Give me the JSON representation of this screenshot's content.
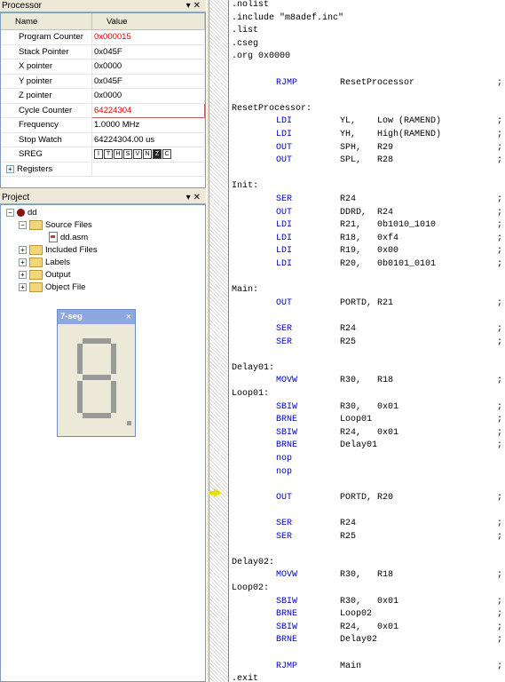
{
  "processor": {
    "title": "Processor",
    "col_name": "Name",
    "col_value": "Value",
    "rows": [
      {
        "name": "Program Counter",
        "value": "0x000015"
      },
      {
        "name": "Stack Pointer",
        "value": "0x045F"
      },
      {
        "name": "X pointer",
        "value": "0x0000"
      },
      {
        "name": "Y pointer",
        "value": "0x045F"
      },
      {
        "name": "Z pointer",
        "value": "0x0000"
      },
      {
        "name": "Cycle Counter",
        "value": "64224304"
      },
      {
        "name": "Frequency",
        "value": "1.0000 MHz"
      },
      {
        "name": "Stop Watch",
        "value": "64224304.00 us"
      },
      {
        "name": "SREG",
        "value": ""
      },
      {
        "name": "Registers",
        "value": ""
      }
    ],
    "sreg_flags": [
      "I",
      "T",
      "H",
      "S",
      "V",
      "N",
      "Z",
      "C"
    ]
  },
  "project": {
    "title": "Project",
    "root": "dd",
    "source_files": "Source Files",
    "file": "dd.asm",
    "included_files": "Included Files",
    "labels": "Labels",
    "output": "Output",
    "object_file": "Object File"
  },
  "seven_seg": {
    "title": "7-seg",
    "close": "×"
  },
  "code_lines": [
    {
      "label": ".nolist"
    },
    {
      "label": ".include \"m8adef.inc\""
    },
    {
      "label": ".list"
    },
    {
      "label": ".cseg"
    },
    {
      "label": ".org 0x0000"
    },
    {
      "label": ""
    },
    {
      "op": "RJMP",
      "args": "ResetProcessor",
      "semi": ";"
    },
    {
      "label": ""
    },
    {
      "label": "ResetProcessor:"
    },
    {
      "op": "LDI",
      "args": "YL,    Low (RAMEND)",
      "semi": ";"
    },
    {
      "op": "LDI",
      "args": "YH,    High(RAMEND)",
      "semi": ";"
    },
    {
      "op": "OUT",
      "args": "SPH,   R29",
      "semi": ";"
    },
    {
      "op": "OUT",
      "args": "SPL,   R28",
      "semi": ";"
    },
    {
      "label": ""
    },
    {
      "label": "Init:"
    },
    {
      "op": "SER",
      "args": "R24",
      "semi": ";"
    },
    {
      "op": "OUT",
      "args": "DDRD,  R24",
      "semi": ";"
    },
    {
      "op": "LDI",
      "args": "R21,   0b1010_1010",
      "semi": ";"
    },
    {
      "op": "LDI",
      "args": "R18,   0xf4",
      "semi": ";"
    },
    {
      "op": "LDI",
      "args": "R19,   0x00",
      "semi": ";"
    },
    {
      "op": "LDI",
      "args": "R20,   0b0101_0101",
      "semi": ";"
    },
    {
      "label": ""
    },
    {
      "label": "Main:"
    },
    {
      "op": "OUT",
      "args": "PORTD, R21",
      "semi": ";"
    },
    {
      "label": ""
    },
    {
      "op": "SER",
      "args": "R24",
      "semi": ";"
    },
    {
      "op": "SER",
      "args": "R25",
      "semi": ";"
    },
    {
      "label": ""
    },
    {
      "label": "Delay01:"
    },
    {
      "op": "MOVW",
      "args": "R30,   R18",
      "semi": ";"
    },
    {
      "label": "Loop01:"
    },
    {
      "op": "SBIW",
      "args": "R30,   0x01",
      "semi": ";"
    },
    {
      "op": "BRNE",
      "args": "Loop01",
      "semi": ";"
    },
    {
      "op": "SBIW",
      "args": "R24,   0x01",
      "semi": ";"
    },
    {
      "op": "BRNE",
      "args": "Delay01",
      "semi": ";"
    },
    {
      "op": "nop",
      "args": "",
      "semi": ""
    },
    {
      "op": "nop",
      "args": "",
      "semi": ""
    },
    {
      "label": ""
    },
    {
      "op": "OUT",
      "args": "PORTD, R20",
      "semi": ";"
    },
    {
      "label": ""
    },
    {
      "op": "SER",
      "args": "R24",
      "semi": ";"
    },
    {
      "op": "SER",
      "args": "R25",
      "semi": ";"
    },
    {
      "label": ""
    },
    {
      "label": "Delay02:"
    },
    {
      "op": "MOVW",
      "args": "R30,   R18",
      "semi": ";"
    },
    {
      "label": "Loop02:"
    },
    {
      "op": "SBIW",
      "args": "R30,   0x01",
      "semi": ";"
    },
    {
      "op": "BRNE",
      "args": "Loop02",
      "semi": ";"
    },
    {
      "op": "SBIW",
      "args": "R24,   0x01",
      "semi": ";"
    },
    {
      "op": "BRNE",
      "args": "Delay02",
      "semi": ";"
    },
    {
      "label": ""
    },
    {
      "op": "RJMP",
      "args": "Main",
      "semi": ";"
    },
    {
      "label": ".exit"
    }
  ],
  "colors": {
    "keyword": "#0000c8",
    "highlight": "#e00000",
    "arrow": "#e8e000"
  }
}
